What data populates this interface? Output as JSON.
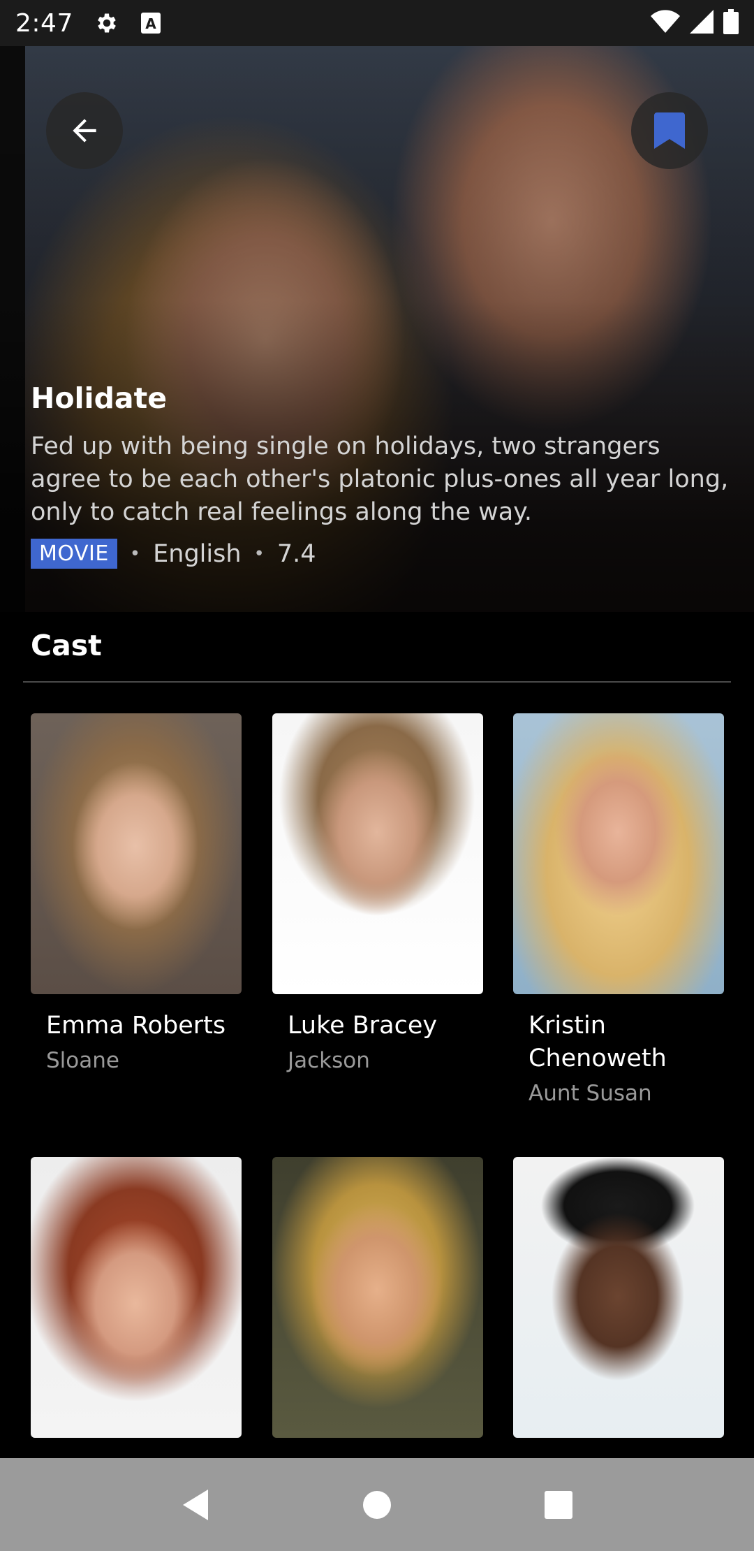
{
  "status_bar": {
    "time": "2:47",
    "icons_left": [
      "gear-icon",
      "text-a-icon"
    ],
    "icons_right": [
      "wifi-icon",
      "signal-icon",
      "battery-icon"
    ]
  },
  "hero": {
    "back_icon": "arrow-left-icon",
    "bookmark_icon": "bookmark-icon",
    "bookmark_color": "#3f67cf",
    "title": "Holidate",
    "description": "Fed up with being single on holidays, two strangers agree to be each other's platonic plus-ones all year long, only to catch real feelings along the way.",
    "type_badge": "MOVIE",
    "language": "English",
    "rating": "7.4",
    "separator": "•"
  },
  "cast": {
    "header": "Cast",
    "members": [
      {
        "name": "Emma Roberts",
        "role": "Sloane"
      },
      {
        "name": "Luke Bracey",
        "role": "Jackson"
      },
      {
        "name": "Kristin Chenoweth",
        "role": "Aunt Susan"
      },
      {
        "name": "",
        "role": ""
      },
      {
        "name": "",
        "role": ""
      },
      {
        "name": "",
        "role": ""
      }
    ]
  },
  "nav_bar": {
    "icons": [
      "nav-back-icon",
      "nav-home-icon",
      "nav-recents-icon"
    ]
  }
}
